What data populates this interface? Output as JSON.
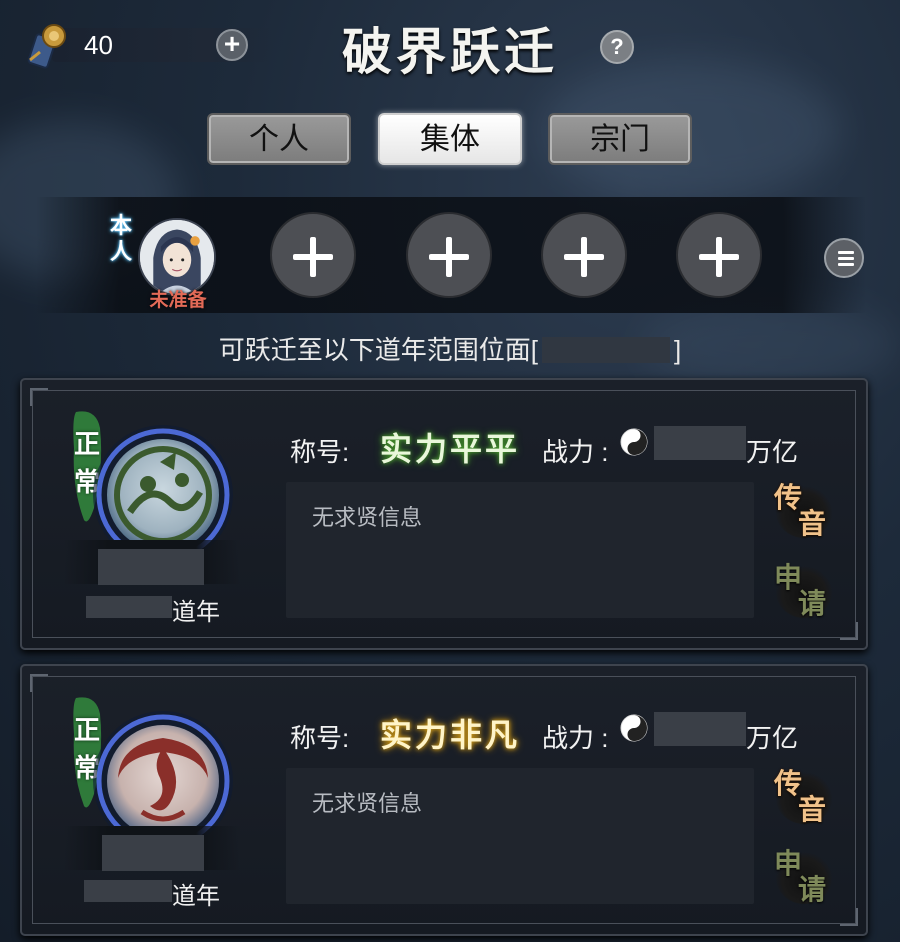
{
  "header": {
    "currency_value": "40",
    "title": "破界跃迁"
  },
  "tabs": [
    {
      "label": "个人",
      "active": false
    },
    {
      "label": "集体",
      "active": true
    },
    {
      "label": "宗门",
      "active": false
    }
  ],
  "team": {
    "self_tag": "本人",
    "self_status": "未准备",
    "empty_slots": 4
  },
  "range_text_prefix": "可跃迁至以下道年范围位面[",
  "range_text_suffix": "]",
  "cards": [
    {
      "status": [
        "正",
        "常"
      ],
      "title_label": "称号:",
      "rank": "实力平平",
      "rank_color": "#4c9f2e",
      "power_label": "战力 :",
      "power_unit": "万亿",
      "years_label": "道年",
      "message": "无求贤信息",
      "btn_message": [
        "传",
        "音"
      ],
      "btn_apply": [
        "申",
        "请"
      ]
    },
    {
      "status": [
        "正",
        "常"
      ],
      "title_label": "称号:",
      "rank": "实力非凡",
      "rank_color": "#d9a31a",
      "power_label": "战力 :",
      "power_unit": "万亿",
      "years_label": "道年",
      "message": "无求贤信息",
      "btn_message": [
        "传",
        "音"
      ],
      "btn_apply": [
        "申",
        "请"
      ]
    }
  ],
  "colors": {
    "background": "#1d2a3a",
    "accent_green": "#2f7a3a",
    "accent_gold": "#d9a31a",
    "not_ready": "#e26a57"
  }
}
